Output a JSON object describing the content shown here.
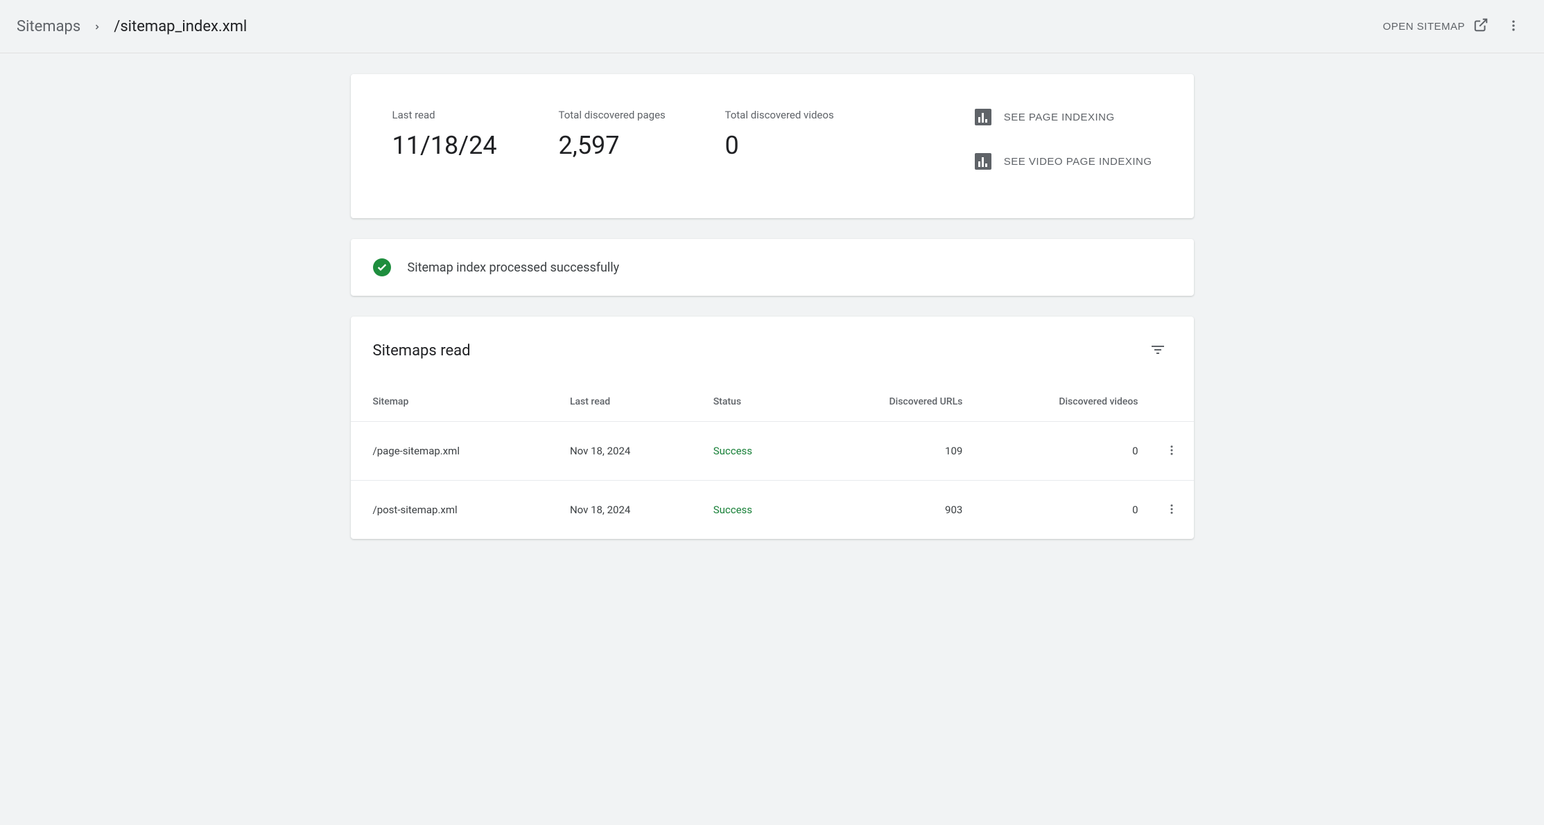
{
  "breadcrumb": {
    "root": "Sitemaps",
    "current": "/sitemap_index.xml"
  },
  "header": {
    "open_sitemap_label": "OPEN SITEMAP"
  },
  "summary": {
    "last_read": {
      "label": "Last read",
      "value": "11/18/24"
    },
    "total_pages": {
      "label": "Total discovered pages",
      "value": "2,597"
    },
    "total_videos": {
      "label": "Total discovered videos",
      "value": "0"
    },
    "page_indexing_link": "SEE PAGE INDEXING",
    "video_indexing_link": "SEE VIDEO PAGE INDEXING"
  },
  "status": {
    "message": "Sitemap index processed successfully"
  },
  "table": {
    "title": "Sitemaps read",
    "columns": {
      "sitemap": "Sitemap",
      "last_read": "Last read",
      "status": "Status",
      "discovered_urls": "Discovered URLs",
      "discovered_videos": "Discovered videos"
    },
    "rows": [
      {
        "sitemap": "/page-sitemap.xml",
        "last_read": "Nov 18, 2024",
        "status": "Success",
        "discovered_urls": "109",
        "discovered_videos": "0"
      },
      {
        "sitemap": "/post-sitemap.xml",
        "last_read": "Nov 18, 2024",
        "status": "Success",
        "discovered_urls": "903",
        "discovered_videos": "0"
      }
    ]
  }
}
